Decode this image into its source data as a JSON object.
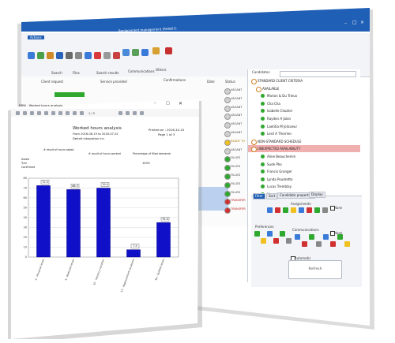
{
  "back_window": {
    "title": "Replacement management (RHW07)",
    "ribbon_tabs": [
      "Actions",
      "Search",
      "Files",
      "Search results",
      "Communications",
      "Others"
    ],
    "ribbon_buttons": [
      "Save",
      "Refresh",
      "Selection",
      "Print",
      "Replacing",
      "Reserve",
      "Break",
      "Add",
      "Send",
      "Activity",
      "Send",
      "Help",
      "Tools and Books",
      "Close"
    ],
    "grid_headers": [
      "Client request",
      "Service provided",
      "Confirmations",
      "Date",
      "Status"
    ],
    "status_values": [
      "VACANT",
      "VACANT",
      "VACANT",
      "VACANT",
      "VACANT",
      "VACANT",
      "READY TO",
      "VACANT",
      "FILLED",
      "FILLED",
      "FILLED",
      "FILLED",
      "FILLED",
      "TRANSFER",
      "TRANSFER"
    ],
    "candidates_label": "Candidates",
    "candidate_sections": [
      "STANDARD CLIENT CRITERIA",
      "AVAILABLE",
      "NON-STANDARD SCHEDULE",
      "UNEXPECTED AVAILABILITY"
    ],
    "candidates": [
      "Marion & Du Trieux",
      "Cha Cha",
      "Isabelle Cloutier",
      "Rayden A Jalon",
      "Laetitia M Jolicoeur",
      "Lesli A Therrien",
      "Aline Beauchemin",
      "Sude Pho",
      "Francis Granger",
      "Lynda Poudrette",
      "Lucas Tremblay",
      "Manuel Refdrences"
    ],
    "panel_tabs": [
      "Filter",
      "Sort",
      "Candidate properties",
      "Display"
    ],
    "filter_groups": [
      "Assignments",
      "Preferences",
      "Communications"
    ],
    "none_label": "None",
    "automatic_label": "Automatic",
    "refresh_label": "Refresh"
  },
  "report_window": {
    "title": "RRW - Worked hours analysis",
    "heading": "Worked hours analysis",
    "period": "From 2016-06-19 to 2016-07-02",
    "subheading": "Detroit integration inc.",
    "printed_on": "Printed on : 2016-10-10",
    "page": "Page 1 of 3",
    "col_labels": [
      "# result of hours asked",
      "# result of hours worked",
      "Percentage of filled demands"
    ],
    "row_labels": [
      "Asked",
      "Turn",
      "Confirmed"
    ],
    "percent_value": "100%",
    "toolbar_page": "1 / 3"
  },
  "chart_data": {
    "type": "bar",
    "categories": [
      "3 - Personal leave",
      "4 - Reduced leave",
      "10 - Vacancy vacation",
      "11 - Replacement vacations",
      "16 - Quitted leave"
    ],
    "values": [
      72.5,
      68.5,
      70,
      7.5,
      35
    ],
    "data_labels": [
      "72.5",
      "68.5",
      "70.0",
      "7.5",
      "35.0"
    ],
    "ylim": [
      0,
      80
    ],
    "yticks": [
      0,
      10,
      20,
      30,
      40,
      50,
      60,
      70,
      80
    ],
    "bar_color": "#1010c8",
    "grid": true
  }
}
